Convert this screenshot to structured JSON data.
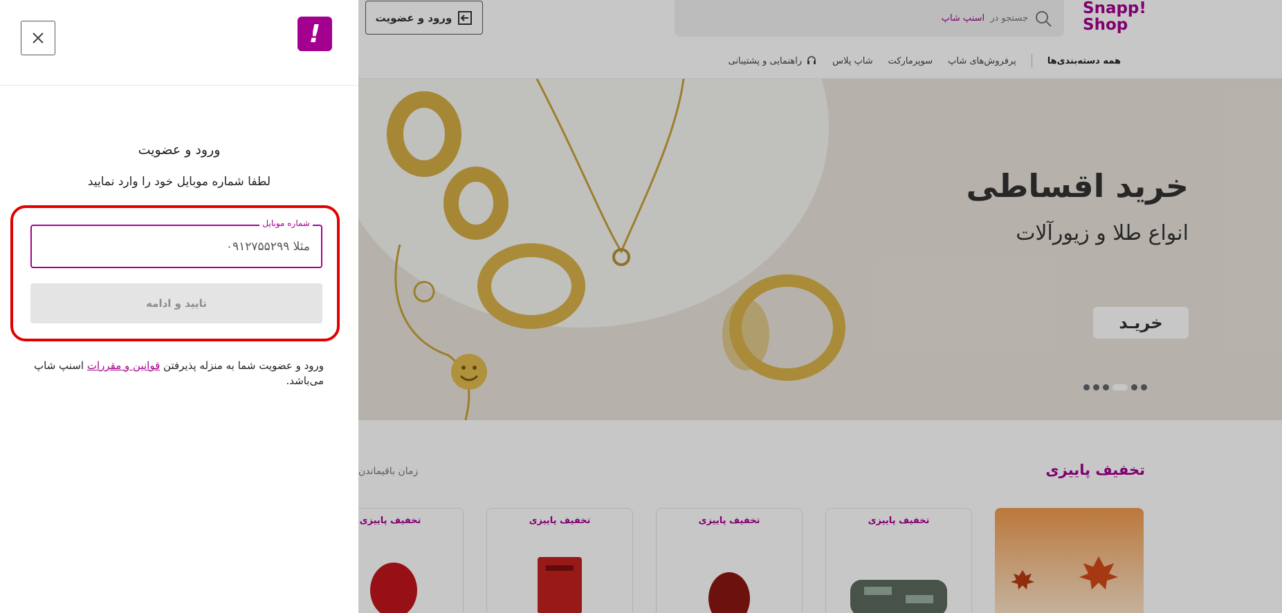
{
  "header": {
    "logo_line1": "Snapp!",
    "logo_line2": "Shop",
    "search_prefix": "جستجو در",
    "search_brand": "اسنپ شاپ",
    "login_label": "ورود و عضویت"
  },
  "nav": {
    "all_categories": "همه دسته‌بندی‌ها",
    "items": [
      "پرفروش‌های شاپ",
      "سوپرمارکت",
      "شاپ پلاس"
    ],
    "help": "راهنمایی و پشتیبانی"
  },
  "banner": {
    "title": "خرید اقساطی",
    "subtitle": "انواع طلا و زیورآلات",
    "button": "خریـد",
    "slide_count": 6,
    "active_slide": 3
  },
  "section": {
    "title": "تخفیف پاییزی",
    "time_left": "زمان باقیماندن"
  },
  "products": [
    {
      "tag": "تخفیف پاییزی"
    },
    {
      "tag": "تخفیف پاییزی"
    },
    {
      "tag": "تخفیف پاییزی"
    },
    {
      "tag": "تخفیف پاییزی"
    }
  ],
  "drawer": {
    "title": "ورود و عضویت",
    "subtitle": "لطفا شماره موبایل خود را وارد نمایید",
    "phone_label": "شماره موبایل",
    "phone_placeholder": "مثلا ۰۹۱۲۷۵۵۲۹۹",
    "phone_value": "",
    "continue_label": "تایید و ادامه",
    "terms_before": "ورود و عضویت شما به منزله پذیرفتن",
    "terms_link": "قوانین و مقررات",
    "terms_after": "اسنپ شاپ می‌باشد."
  },
  "colors": {
    "brand": "#a4008f",
    "highlight": "#e00000",
    "disabled_button": "#e4e4e4"
  }
}
